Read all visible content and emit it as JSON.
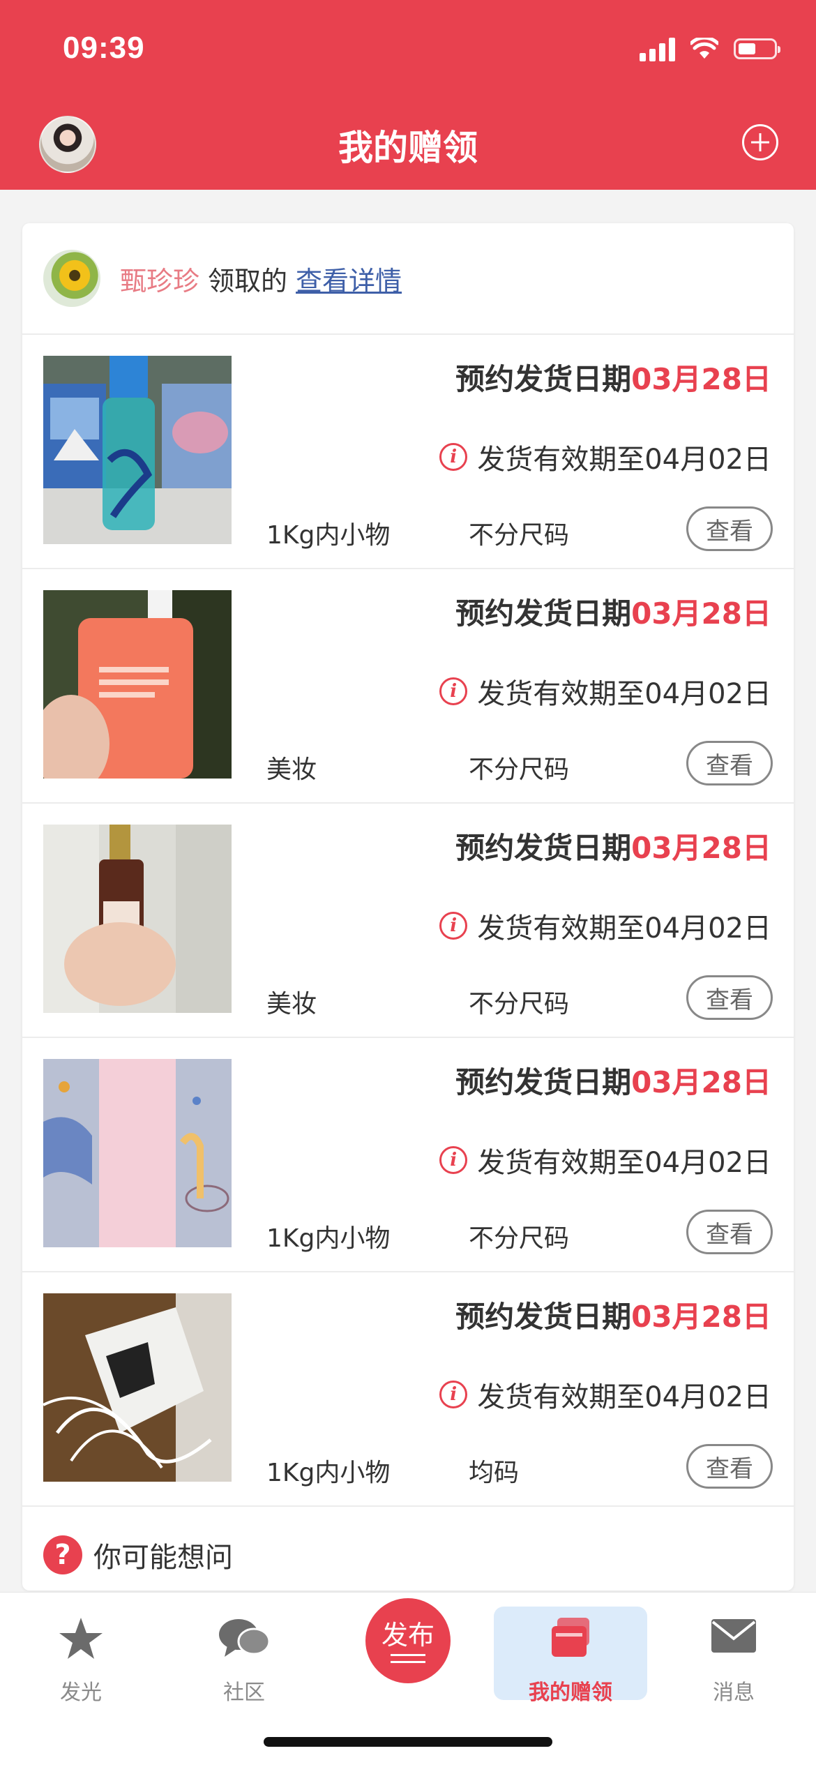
{
  "status_bar": {
    "time": "09:39"
  },
  "header": {
    "title": "我的赠领"
  },
  "recipient": {
    "name": "甄珍珍",
    "action": "领取的",
    "link": "查看详情"
  },
  "items": [
    {
      "ship_label": "预约发货日期",
      "ship_date": "03月28日",
      "valid_text": "发货有效期至04月02日",
      "category": "1Kg内小物",
      "size": "不分尺码",
      "view_label": "查看"
    },
    {
      "ship_label": "预约发货日期",
      "ship_date": "03月28日",
      "valid_text": "发货有效期至04月02日",
      "category": "美妆",
      "size": "不分尺码",
      "view_label": "查看"
    },
    {
      "ship_label": "预约发货日期",
      "ship_date": "03月28日",
      "valid_text": "发货有效期至04月02日",
      "category": "美妆",
      "size": "不分尺码",
      "view_label": "查看"
    },
    {
      "ship_label": "预约发货日期",
      "ship_date": "03月28日",
      "valid_text": "发货有效期至04月02日",
      "category": "1Kg内小物",
      "size": "不分尺码",
      "view_label": "查看"
    },
    {
      "ship_label": "预约发货日期",
      "ship_date": "03月28日",
      "valid_text": "发货有效期至04月02日",
      "category": "1Kg内小物",
      "size": "均码",
      "view_label": "查看"
    }
  ],
  "faq": {
    "icon": "?",
    "label": "你可能想问"
  },
  "tabbar": {
    "tabs": [
      {
        "label": "发光",
        "icon": "star-icon"
      },
      {
        "label": "社区",
        "icon": "chat-icon"
      },
      {
        "label": "发布",
        "icon": "publish-icon"
      },
      {
        "label": "我的赠领",
        "icon": "gift-cards-icon"
      },
      {
        "label": "消息",
        "icon": "mail-icon"
      }
    ],
    "active": "我的赠领"
  },
  "colors": {
    "accent": "#e8414f",
    "link": "#3e5fa8",
    "active_tab_bg": "#dcebfa"
  }
}
